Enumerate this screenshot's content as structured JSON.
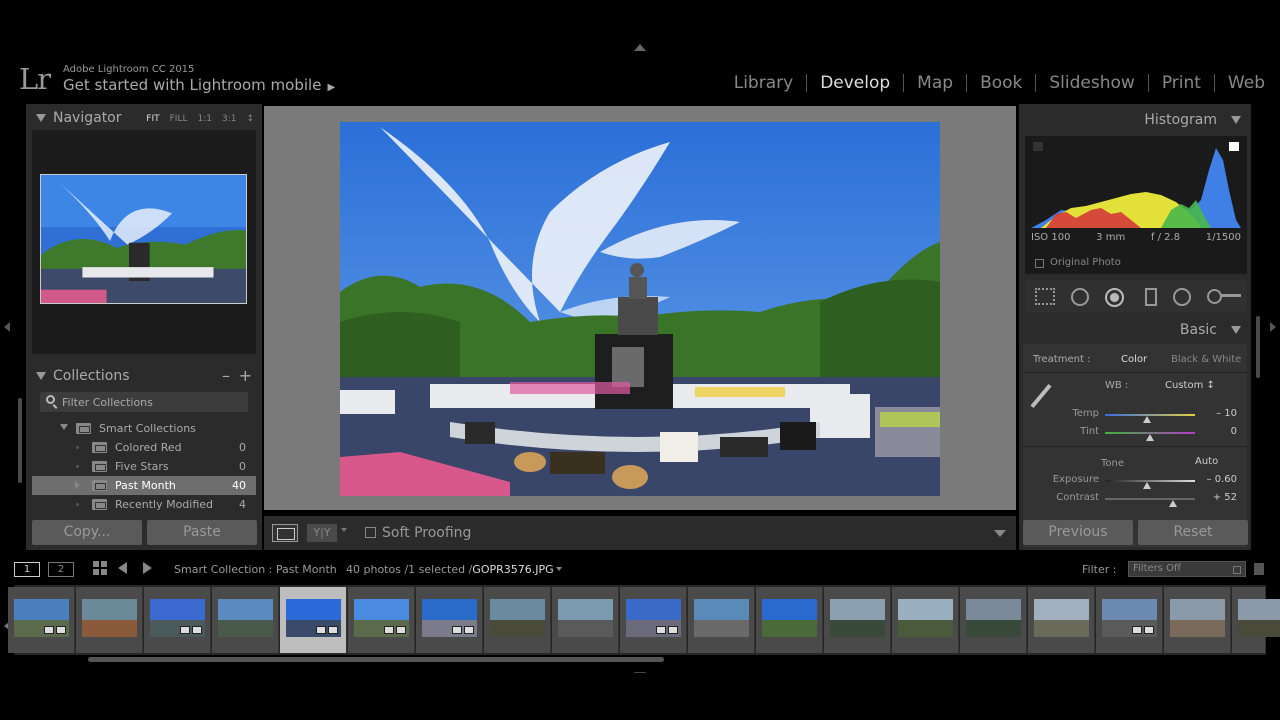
{
  "app": {
    "logo": "Lr",
    "version": "Adobe Lightroom CC 2015",
    "mobile_prompt": "Get started with Lightroom mobile"
  },
  "modules": [
    "Library",
    "Develop",
    "Map",
    "Book",
    "Slideshow",
    "Print",
    "Web"
  ],
  "active_module": "Develop",
  "navigator": {
    "title": "Navigator",
    "zoom": [
      "FIT",
      "FILL",
      "1:1",
      "3:1"
    ],
    "zoom_more": "↕"
  },
  "collections": {
    "title": "Collections",
    "minus": "–",
    "plus": "+",
    "filter_placeholder": "Filter Collections",
    "items": [
      {
        "name": "Smart Collections",
        "count": ""
      },
      {
        "name": "Colored Red",
        "count": "0"
      },
      {
        "name": "Five Stars",
        "count": "0"
      },
      {
        "name": "Past Month",
        "count": "40"
      },
      {
        "name": "Recently Modified",
        "count": "4"
      }
    ]
  },
  "left_buttons": {
    "copy": "Copy...",
    "paste": "Paste"
  },
  "toolbar": {
    "yy": "Y|Y",
    "soft_proofing": "Soft Proofing"
  },
  "histogram": {
    "title": "Histogram",
    "iso": "ISO 100",
    "focal": "3 mm",
    "aperture": "f / 2.8",
    "shutter": "1/1500",
    "original_photo": "Original Photo"
  },
  "basic": {
    "title": "Basic",
    "treatment_label": "Treatment :",
    "treatment_color": "Color",
    "treatment_bw": "Black & White",
    "wb_label": "WB :",
    "wb_value": "Custom ↕",
    "temp_label": "Temp",
    "temp_value": "– 10",
    "temp_level": 0.47,
    "tint_label": "Tint",
    "tint_value": "0",
    "tint_level": 0.5,
    "tone_label": "Tone",
    "auto_label": "Auto",
    "exposure_label": "Exposure",
    "exposure_value": "– 0.60",
    "exposure_level": 0.47,
    "contrast_label": "Contrast",
    "contrast_value": "+ 52",
    "contrast_level": 0.76
  },
  "right_buttons": {
    "previous": "Previous",
    "reset": "Reset"
  },
  "filmstrip_bar": {
    "view1": "1",
    "view2": "2",
    "source": "Smart Collection : Past Month",
    "count": "40 photos /1 selected /",
    "file": "GOPR3576.JPG",
    "filter_label": "Filter :",
    "filter_value": "Filters Off"
  },
  "filmstrip": {
    "selected_index": 4,
    "thumbs": [
      {
        "sky": "#4a7fc0",
        "ground": "#5a6a4a",
        "badge": true
      },
      {
        "sky": "#6a8a9a",
        "ground": "#8a5a3a",
        "badge": false
      },
      {
        "sky": "#3a6ad0",
        "ground": "#4a5a5a",
        "badge": true
      },
      {
        "sky": "#5a8ac0",
        "ground": "#4a5a4a",
        "badge": false
      },
      {
        "sky": "#2a6ad8",
        "ground": "#3a4a6a",
        "badge": true
      },
      {
        "sky": "#4a8ae0",
        "ground": "#5a6a4a",
        "badge": true
      },
      {
        "sky": "#2a6ac8",
        "ground": "#7a7a8a",
        "badge": true
      },
      {
        "sky": "#6a8aa0",
        "ground": "#4a4a3a",
        "badge": false
      },
      {
        "sky": "#7a9ab0",
        "ground": "#5a5a5a",
        "badge": false
      },
      {
        "sky": "#3a6ac8",
        "ground": "#6a6a7a",
        "badge": true
      },
      {
        "sky": "#5a8ab8",
        "ground": "#6a6a6a",
        "badge": false
      },
      {
        "sky": "#2a6ad0",
        "ground": "#4a6a3a",
        "badge": false
      },
      {
        "sky": "#8aa0b0",
        "ground": "#3a4a3a",
        "badge": false
      },
      {
        "sky": "#9ab0c0",
        "ground": "#4a5a3a",
        "badge": false
      },
      {
        "sky": "#7a8a9a",
        "ground": "#3a4a3a",
        "badge": false
      },
      {
        "sky": "#a0b0c0",
        "ground": "#6a6a5a",
        "badge": false
      },
      {
        "sky": "#6a8ab0",
        "ground": "#5a5a5a",
        "badge": true
      },
      {
        "sky": "#8a9aa8",
        "ground": "#7a6a5a",
        "badge": false
      },
      {
        "sky": "#8a9aaa",
        "ground": "#4a4a3a",
        "badge": false
      }
    ]
  },
  "colors": {
    "panel": "#2b2b2b",
    "view_bg": "#7a7a7a",
    "active_text": "#dddddd",
    "hist_blue": "#3f7fe6",
    "hist_yellow": "#e4e03a",
    "hist_red": "#d33a3a",
    "hist_green": "#48b84a"
  }
}
